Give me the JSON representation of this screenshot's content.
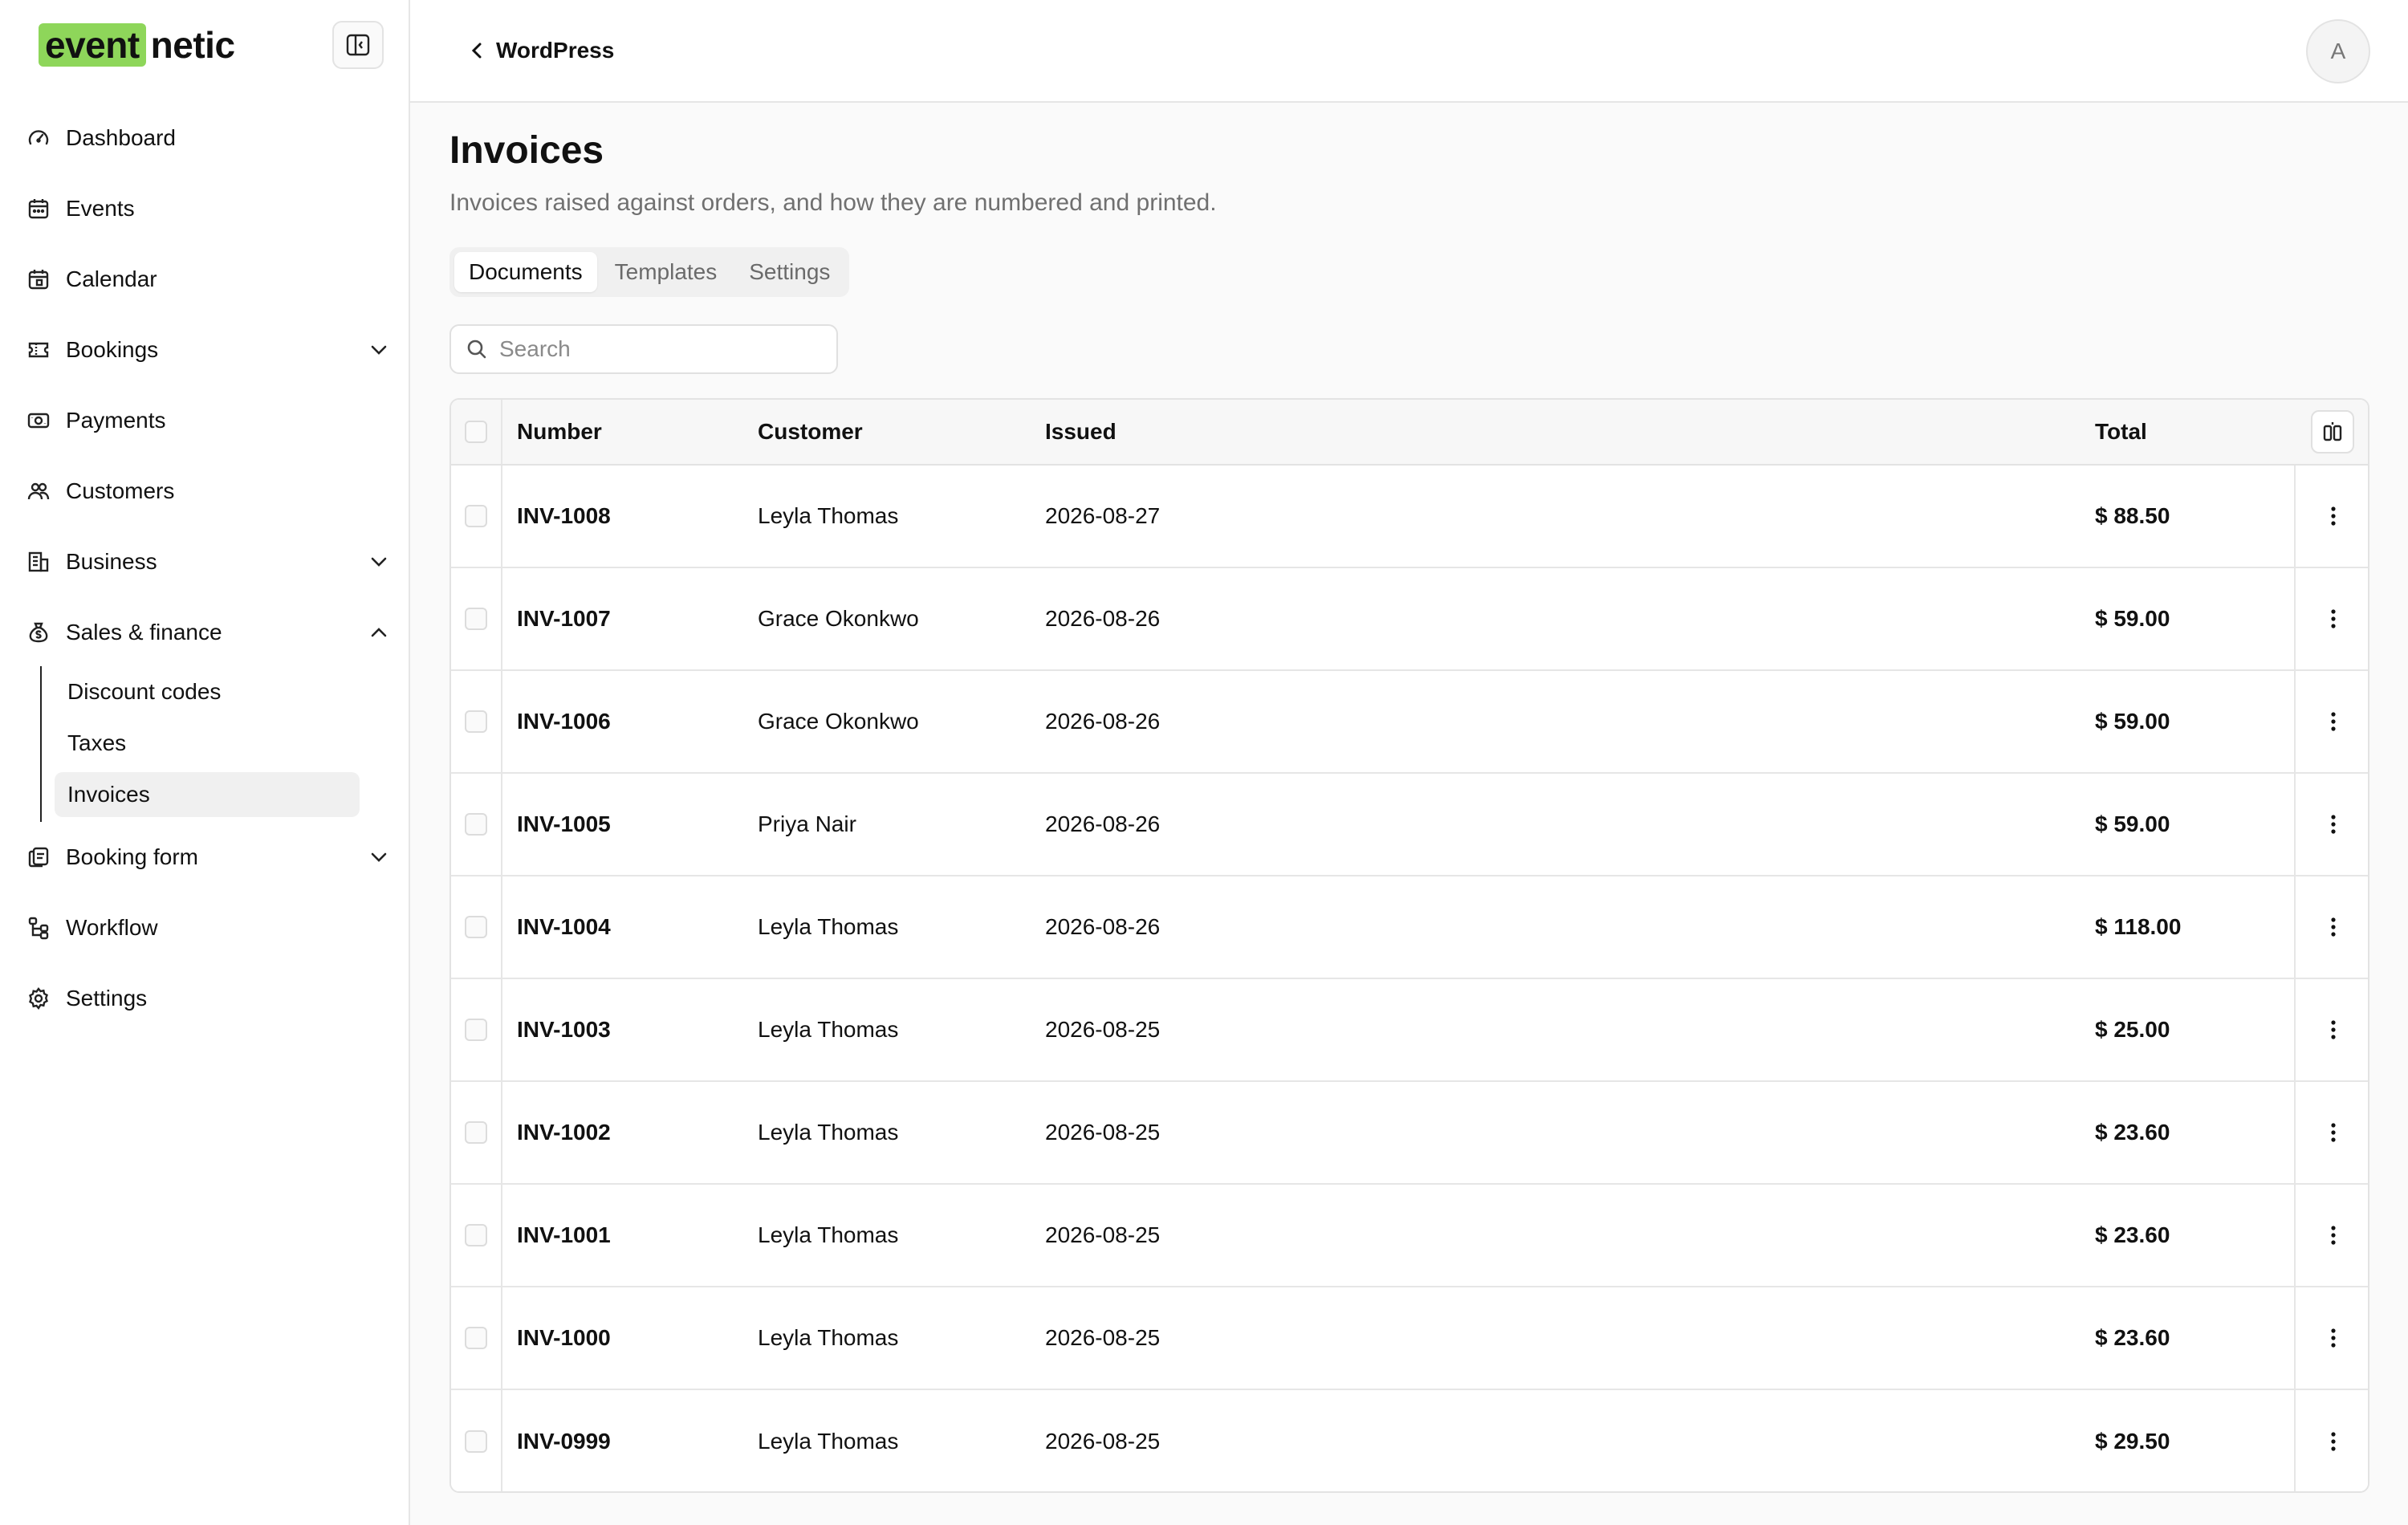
{
  "brand": {
    "highlight": "event",
    "rest": "netic",
    "accent": "#8ed65a"
  },
  "sidebar": {
    "items": [
      {
        "label": "Dashboard",
        "icon": "gauge-icon"
      },
      {
        "label": "Events",
        "icon": "calendar-icon"
      },
      {
        "label": "Calendar",
        "icon": "calendar-grid-icon"
      },
      {
        "label": "Bookings",
        "icon": "ticket-icon"
      },
      {
        "label": "Payments",
        "icon": "cash-icon"
      },
      {
        "label": "Customers",
        "icon": "users-icon"
      },
      {
        "label": "Business",
        "icon": "building-icon"
      },
      {
        "label": "Sales & finance",
        "icon": "money-bag-icon"
      },
      {
        "label": "Booking form",
        "icon": "form-icon"
      },
      {
        "label": "Workflow",
        "icon": "workflow-icon"
      },
      {
        "label": "Settings",
        "icon": "gear-icon"
      }
    ],
    "subitems": [
      {
        "label": "Discount codes"
      },
      {
        "label": "Taxes"
      },
      {
        "label": "Invoices"
      }
    ]
  },
  "topbar": {
    "back_label": "WordPress",
    "avatar_initial": "A"
  },
  "page": {
    "title": "Invoices",
    "description": "Invoices raised against orders, and how they are numbered and printed."
  },
  "tabs": [
    {
      "label": "Documents"
    },
    {
      "label": "Templates"
    },
    {
      "label": "Settings"
    }
  ],
  "search": {
    "placeholder": "Search"
  },
  "table": {
    "headers": {
      "number": "Number",
      "customer": "Customer",
      "issued": "Issued",
      "total": "Total"
    },
    "rows": [
      {
        "number": "INV-1008",
        "customer": "Leyla Thomas",
        "issued": "2026-08-27",
        "total": "$ 88.50"
      },
      {
        "number": "INV-1007",
        "customer": "Grace Okonkwo",
        "issued": "2026-08-26",
        "total": "$ 59.00"
      },
      {
        "number": "INV-1006",
        "customer": "Grace Okonkwo",
        "issued": "2026-08-26",
        "total": "$ 59.00"
      },
      {
        "number": "INV-1005",
        "customer": "Priya Nair",
        "issued": "2026-08-26",
        "total": "$ 59.00"
      },
      {
        "number": "INV-1004",
        "customer": "Leyla Thomas",
        "issued": "2026-08-26",
        "total": "$ 118.00"
      },
      {
        "number": "INV-1003",
        "customer": "Leyla Thomas",
        "issued": "2026-08-25",
        "total": "$ 25.00"
      },
      {
        "number": "INV-1002",
        "customer": "Leyla Thomas",
        "issued": "2026-08-25",
        "total": "$ 23.60"
      },
      {
        "number": "INV-1001",
        "customer": "Leyla Thomas",
        "issued": "2026-08-25",
        "total": "$ 23.60"
      },
      {
        "number": "INV-1000",
        "customer": "Leyla Thomas",
        "issued": "2026-08-25",
        "total": "$ 23.60"
      },
      {
        "number": "INV-0999",
        "customer": "Leyla Thomas",
        "issued": "2026-08-25",
        "total": "$ 29.50"
      }
    ]
  }
}
